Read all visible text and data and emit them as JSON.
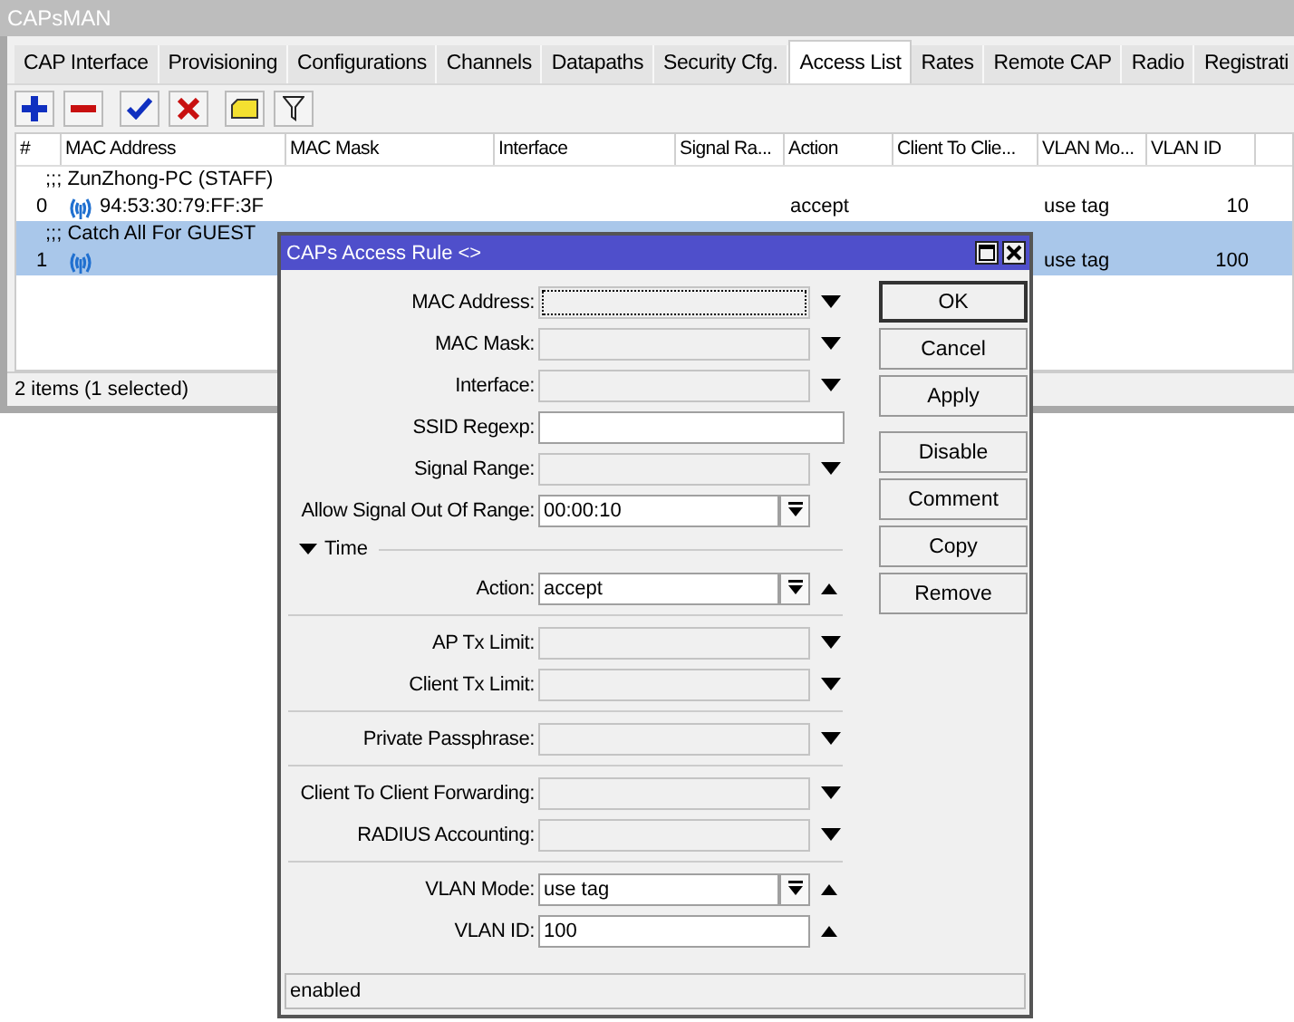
{
  "window": {
    "title": "CAPsMAN"
  },
  "tabs": [
    {
      "label": "CAP Interface",
      "selected": false
    },
    {
      "label": "Provisioning",
      "selected": false
    },
    {
      "label": "Configurations",
      "selected": false
    },
    {
      "label": "Channels",
      "selected": false
    },
    {
      "label": "Datapaths",
      "selected": false
    },
    {
      "label": "Security Cfg.",
      "selected": false
    },
    {
      "label": "Access List",
      "selected": true
    },
    {
      "label": "Rates",
      "selected": false
    },
    {
      "label": "Remote CAP",
      "selected": false
    },
    {
      "label": "Radio",
      "selected": false
    },
    {
      "label": "Registrati",
      "selected": false
    }
  ],
  "table": {
    "columns": [
      "#",
      "MAC Address",
      "MAC Mask",
      "Interface",
      "Signal Ra...",
      "Action",
      "Client To Clie...",
      "VLAN Mo...",
      "VLAN ID"
    ],
    "rows": [
      {
        "kind": "comment",
        "text": ";;; ZunZhong-PC (STAFF)",
        "selected": false
      },
      {
        "kind": "item",
        "number": "0",
        "mac": "94:53:30:79:FF:3F",
        "action": "accept",
        "vlan_mode": "use tag",
        "vlan_id": "10",
        "selected": false
      },
      {
        "kind": "comment",
        "text": ";;; Catch All For GUEST",
        "selected": true
      },
      {
        "kind": "item",
        "number": "1",
        "vlan_mode": "use tag",
        "vlan_id": "100",
        "selected": true
      }
    ]
  },
  "status_bar": "2 items (1 selected)",
  "dialog": {
    "title": "CAPs Access Rule <>",
    "fields": [
      {
        "kind": "field",
        "label": "MAC Address:",
        "disabled": true,
        "focused": true,
        "dropdown": true
      },
      {
        "kind": "field",
        "label": "MAC Mask:",
        "disabled": true,
        "dropdown": true
      },
      {
        "kind": "field",
        "label": "Interface:",
        "disabled": true,
        "dropdown": true
      },
      {
        "kind": "field",
        "label": "SSID Regexp:",
        "disabled": false,
        "wide": true
      },
      {
        "kind": "field",
        "label": "Signal Range:",
        "disabled": true,
        "dropdown": true
      },
      {
        "kind": "field",
        "label": "Allow Signal Out Of Range:",
        "value": "00:00:10",
        "disabled": false,
        "spinner": true
      },
      {
        "kind": "section",
        "label": "Time"
      },
      {
        "kind": "field",
        "label": "Action:",
        "value": "accept",
        "disabled": false,
        "spinner": true,
        "removable": true
      },
      {
        "kind": "divider"
      },
      {
        "kind": "field",
        "label": "AP Tx Limit:",
        "disabled": true,
        "dropdown": true
      },
      {
        "kind": "field",
        "label": "Client Tx Limit:",
        "disabled": true,
        "dropdown": true
      },
      {
        "kind": "divider"
      },
      {
        "kind": "field",
        "label": "Private Passphrase:",
        "disabled": true,
        "dropdown": true
      },
      {
        "kind": "divider"
      },
      {
        "kind": "field",
        "label": "Client To Client Forwarding:",
        "disabled": true,
        "dropdown": true
      },
      {
        "kind": "field",
        "label": "RADIUS Accounting:",
        "disabled": true,
        "dropdown": true
      },
      {
        "kind": "divider"
      },
      {
        "kind": "field",
        "label": "VLAN Mode:",
        "value": "use tag",
        "disabled": false,
        "spinner": true,
        "removable": true
      },
      {
        "kind": "field",
        "label": "VLAN ID:",
        "value": "100",
        "disabled": false,
        "removable": true
      }
    ],
    "button_groups": [
      [
        {
          "label": "OK",
          "default": true
        },
        {
          "label": "Cancel",
          "default": false
        },
        {
          "label": "Apply",
          "default": false
        }
      ],
      [
        {
          "label": "Disable",
          "default": false
        },
        {
          "label": "Comment",
          "default": false
        },
        {
          "label": "Copy",
          "default": false
        },
        {
          "label": "Remove",
          "default": false
        }
      ]
    ],
    "status": "enabled"
  }
}
